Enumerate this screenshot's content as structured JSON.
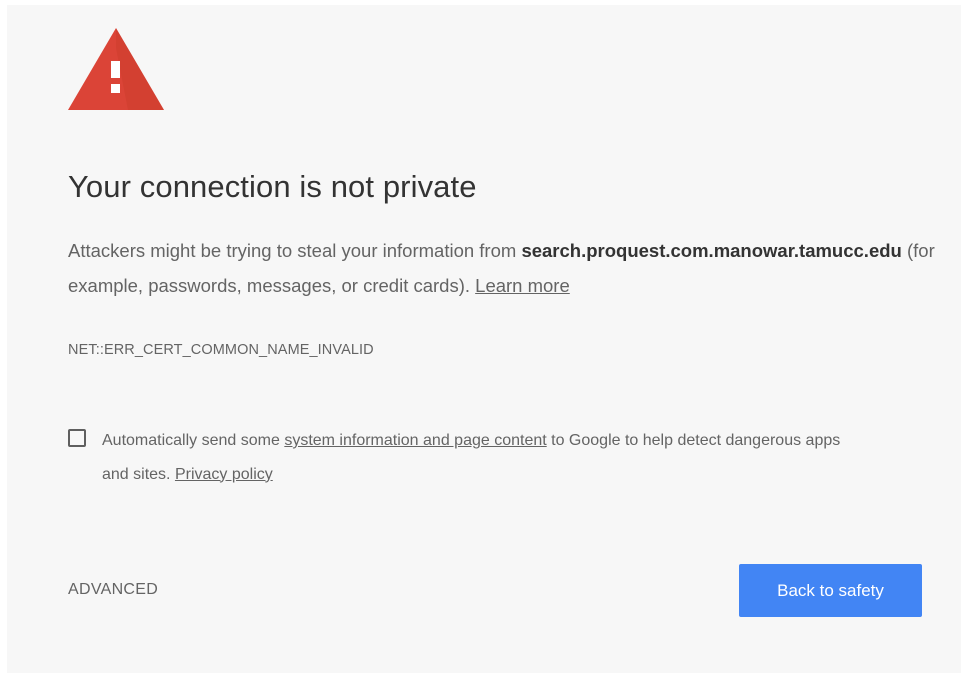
{
  "icon": "warning-triangle-icon",
  "colors": {
    "warning_red": "#db4437",
    "primary_button": "#4285f4",
    "background": "#f7f7f7"
  },
  "heading": "Your connection is not private",
  "description": {
    "prefix": "Attackers might be trying to steal your information from ",
    "host": "search.proquest.com.manowar.tamucc.edu",
    "suffix": " (for example, passwords, messages, or credit cards). ",
    "learn_more": "Learn more"
  },
  "error_code": "NET::ERR_CERT_COMMON_NAME_INVALID",
  "optin": {
    "checked": false,
    "prefix": "Automatically send some ",
    "link1": "system information and page content",
    "middle": " to Google to help detect dangerous apps and sites. ",
    "link2": "Privacy policy"
  },
  "buttons": {
    "advanced": "ADVANCED",
    "back_to_safety": "Back to safety"
  }
}
